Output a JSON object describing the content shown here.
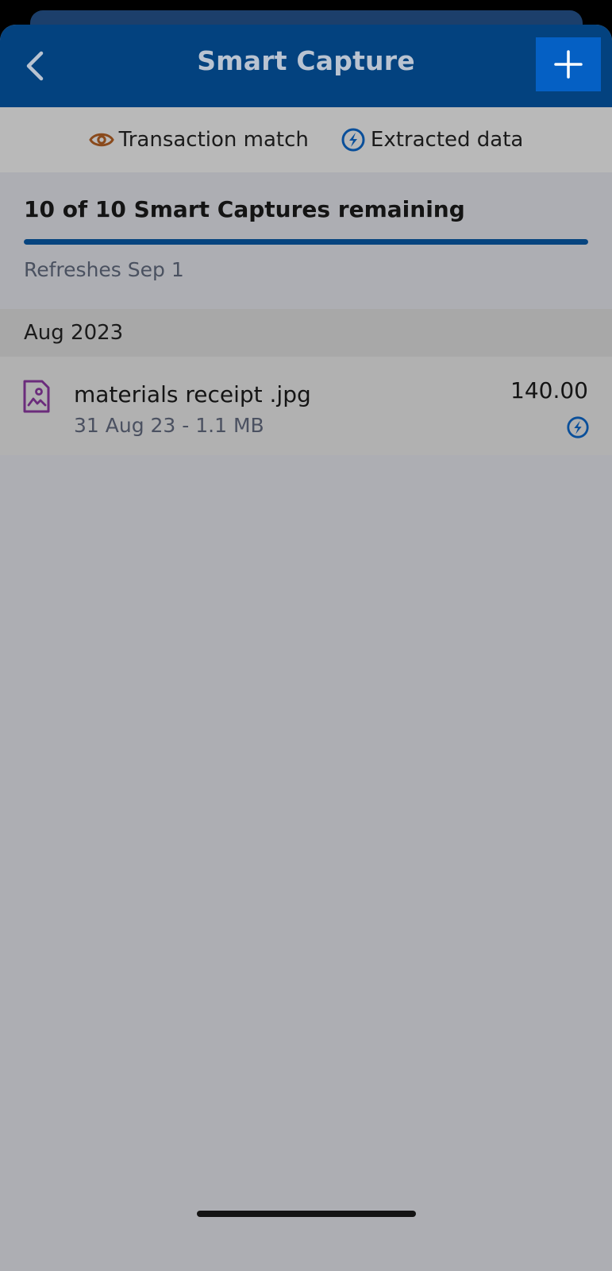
{
  "header": {
    "title": "Smart Capture",
    "back_icon": "chevron-left-icon",
    "add_icon": "plus-icon"
  },
  "legend": {
    "transaction_match": "Transaction match",
    "extracted_data": "Extracted data"
  },
  "quota": {
    "title": "10 of 10 Smart Captures remaining",
    "progress": 1.0,
    "refresh": "Refreshes Sep 1"
  },
  "sections": [
    {
      "label": "Aug 2023",
      "items": [
        {
          "name": "materials receipt .jpg",
          "meta": "31 Aug 23 - 1.1 MB",
          "amount": "140.00"
        }
      ]
    }
  ],
  "colors": {
    "header_bg": "#03427f",
    "add_button_bg": "#0560c4",
    "eye_icon": "#8a4a1c",
    "extract_icon": "#0a4f9a",
    "file_icon": "#6b2c7c"
  }
}
